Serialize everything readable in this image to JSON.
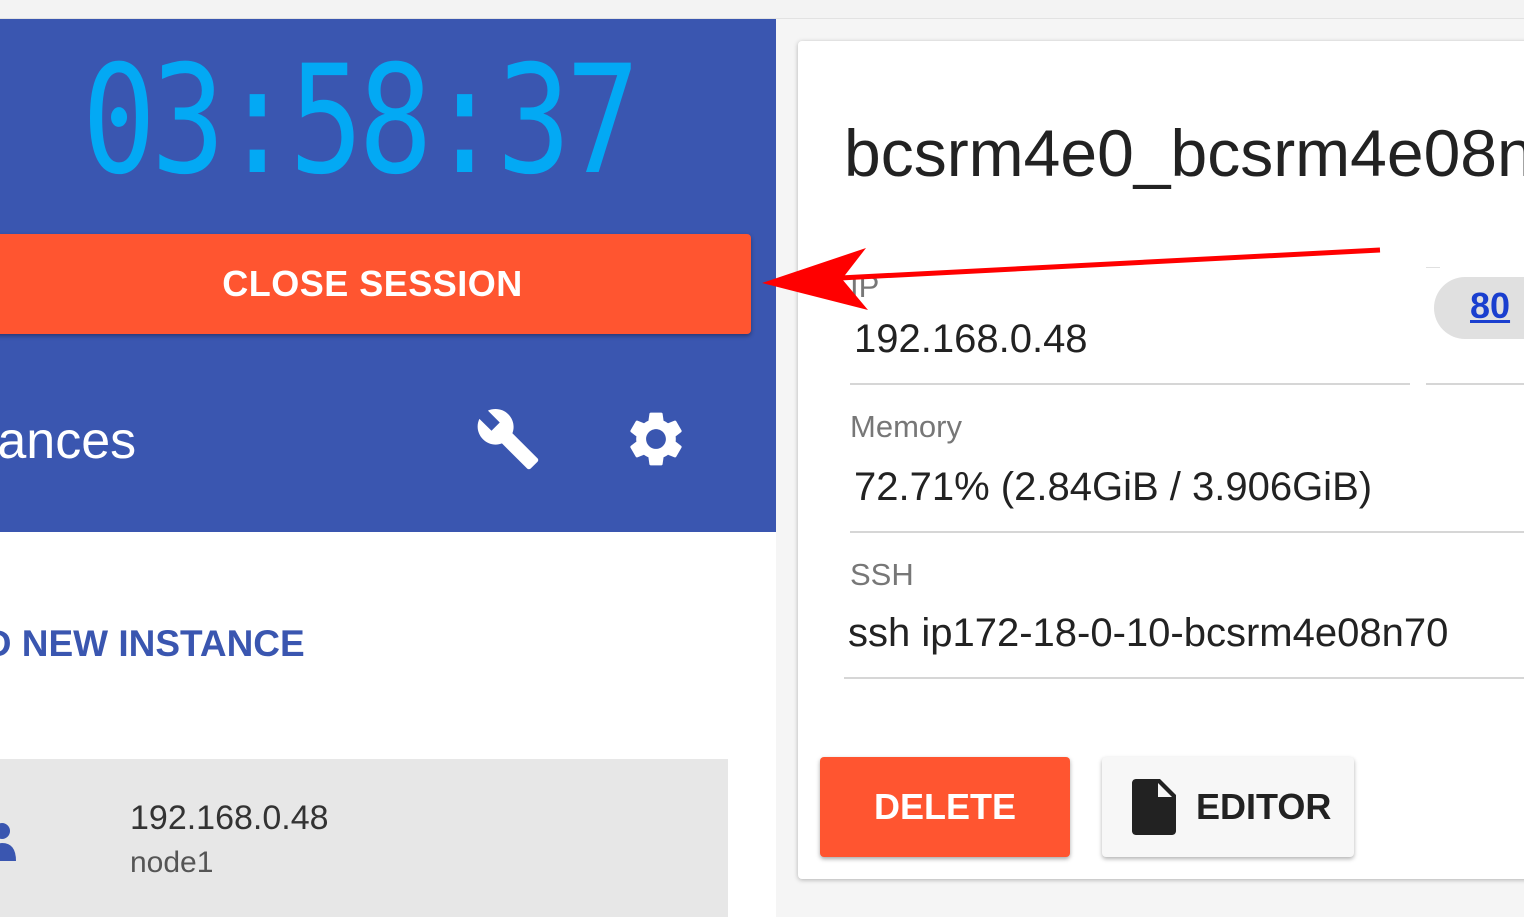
{
  "session": {
    "timer": "03:58:37",
    "close_label": "CLOSE SESSION",
    "instances_title": "nstances",
    "add_instance_label": "DD NEW INSTANCE",
    "tools": {
      "wrench_icon": "wrench-icon",
      "settings_icon": "gear-icon"
    }
  },
  "instances": [
    {
      "ip": "192.168.0.48",
      "name": "node1"
    }
  ],
  "instance_detail": {
    "title": "bcsrm4e0_bcsrm4e08n",
    "ip_label": "IP",
    "ip_value": "192.168.0.48",
    "port_link": "80",
    "memory_label": "Memory",
    "memory_value": "72.71% (2.84GiB / 3.906GiB)",
    "ssh_label": "SSH",
    "ssh_value": "ssh ip172-18-0-10-bcsrm4e08n70",
    "delete_label": "DELETE",
    "editor_label": "EDITOR"
  },
  "annotation": {
    "arrow_color": "#ff0000"
  },
  "colors": {
    "primary": "#3a56b0",
    "timer": "#03a9f4",
    "danger": "#ff5530",
    "link": "#1a3fcf"
  }
}
